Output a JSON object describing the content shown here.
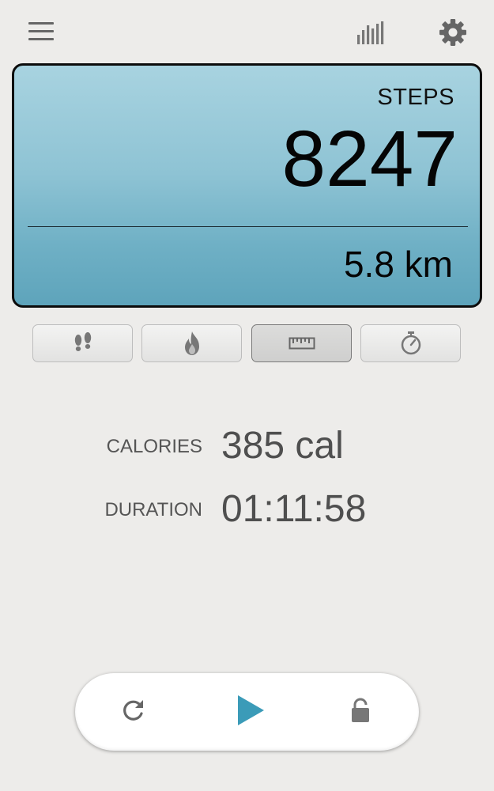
{
  "display": {
    "label": "STEPS",
    "value": "8247",
    "secondary": "5.8 km"
  },
  "modes": [
    {
      "icon": "footprints-icon",
      "active": false
    },
    {
      "icon": "flame-icon",
      "active": false
    },
    {
      "icon": "ruler-icon",
      "active": true
    },
    {
      "icon": "stopwatch-icon",
      "active": false
    }
  ],
  "stats": {
    "calories": {
      "label": "CALORIES",
      "value": "385 cal"
    },
    "duration": {
      "label": "DURATION",
      "value": "01:11:58"
    }
  },
  "colors": {
    "background": "#edecea",
    "display_top": "#a8d3e0",
    "display_bottom": "#5ea4bb",
    "accent": "#3b9bb8",
    "icon_gray": "#666666"
  },
  "controls": {
    "icons": [
      "reset-icon",
      "play-icon",
      "lock-icon"
    ]
  }
}
